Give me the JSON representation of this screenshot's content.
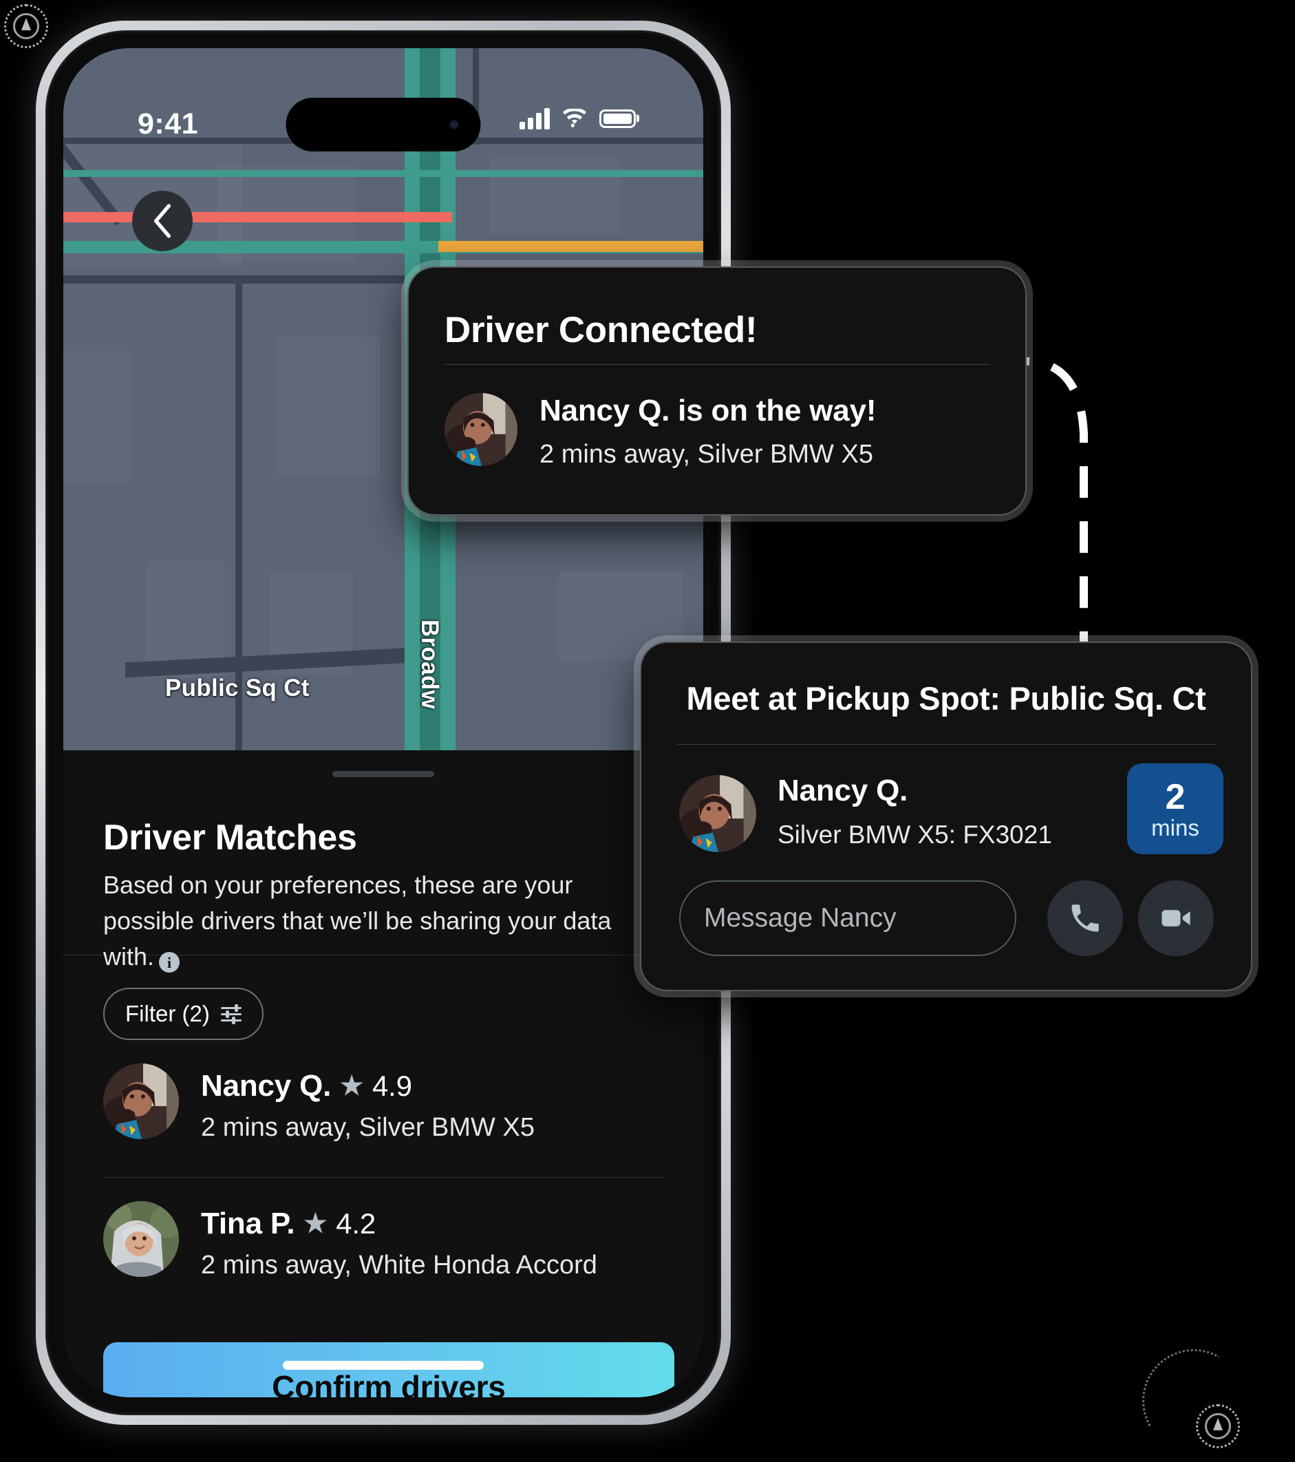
{
  "status_bar": {
    "time": "9:41",
    "icons": [
      "cellular-signal-icon",
      "wifi-icon",
      "battery-icon"
    ]
  },
  "map": {
    "labels": [
      {
        "name": "public-sq-ct",
        "text": "Public Sq Ct"
      },
      {
        "name": "broadway",
        "text": "Broadw"
      }
    ],
    "colors": {
      "background": "#5b6576",
      "block": "#4e5867",
      "road_teal": "#3f9c8d",
      "road_dark": "#3b4452",
      "road_red": "#ef6a63",
      "road_amber": "#e8a63a"
    },
    "back_button_icon": "chevron-left-icon"
  },
  "sheet": {
    "title": "Driver Matches",
    "subtitle": "Based on your preferences, these are your possible drivers that we’ll be sharing your data with.",
    "info_icon_label": "i",
    "filter_label": "Filter (2)",
    "filter_icon": "sliders-icon",
    "drivers": [
      {
        "name": "Nancy Q.",
        "rating": "4.9",
        "meta": "2 mins away, Silver BMW X5",
        "star_icon": "star-icon"
      },
      {
        "name": "Tina P.",
        "rating": "4.2",
        "meta": "2 mins away, White Honda Accord",
        "star_icon": "star-icon"
      }
    ],
    "confirm_label": "Confirm drivers",
    "confirm_gradient_from": "#5aadef",
    "confirm_gradient_to": "#62dcea"
  },
  "card_connected": {
    "title": "Driver Connected!",
    "headline": "Nancy Q. is on the way!",
    "subtext": "2 mins away, Silver BMW X5",
    "avatar": "nancy-avatar"
  },
  "card_pickup": {
    "title": "Meet at Pickup Spot: Public Sq. Ct",
    "driver_name": "Nancy Q.",
    "vehicle": "Silver BMW X5: FX3021",
    "eta_value": "2",
    "eta_unit": "mins",
    "eta_badge_color": "#14508f",
    "message_placeholder": "Message Nancy",
    "call_icon": "phone-icon",
    "video_icon": "video-camera-icon",
    "avatar": "nancy-avatar"
  }
}
